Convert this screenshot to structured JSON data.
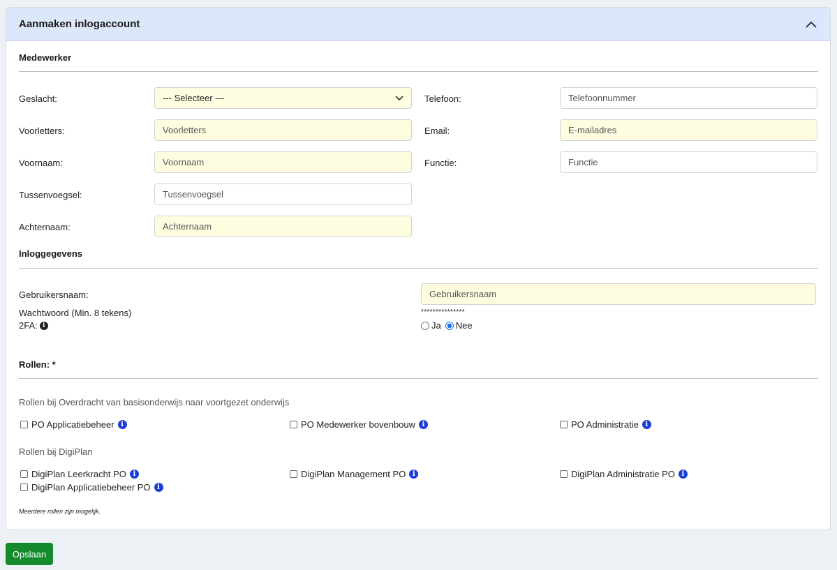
{
  "card": {
    "title": "Aanmaken inlogaccount"
  },
  "medewerker": {
    "section_title": "Medewerker",
    "geslacht": {
      "label": "Geslacht:",
      "value": "--- Selecteer ---"
    },
    "voorletters": {
      "label": "Voorletters:",
      "placeholder": "Voorletters"
    },
    "voornaam": {
      "label": "Voornaam:",
      "placeholder": "Voornaam"
    },
    "tussenvoegsel": {
      "label": "Tussenvoegsel:",
      "placeholder": "Tussenvoegsel"
    },
    "achternaam": {
      "label": "Achternaam:",
      "placeholder": "Achternaam"
    },
    "telefoon": {
      "label": "Telefoon:",
      "placeholder": "Telefoonnummer"
    },
    "email": {
      "label": "Email:",
      "placeholder": "E-mailadres"
    },
    "functie": {
      "label": "Functie:",
      "placeholder": "Functie"
    }
  },
  "inloggegevens": {
    "section_title": "Inloggegevens",
    "gebruikersnaam": {
      "label": "Gebruikersnaam:",
      "placeholder": "Gebruikersnaam"
    },
    "wachtwoord": {
      "label": "Wachtwoord (Min. 8 tekens)",
      "value": "***************"
    },
    "twofa": {
      "label": "2FA:",
      "option_ja": "Ja",
      "option_nee": "Nee",
      "selected": "Nee"
    }
  },
  "rollen": {
    "section_title": "Rollen: *",
    "groups": [
      {
        "title": "Rollen bij Overdracht van basisonderwijs naar voortgezet onderwijs",
        "roles": [
          "PO Applicatiebeheer",
          "PO Medewerker bovenbouw",
          "PO Administratie"
        ]
      },
      {
        "title": "Rollen bij DigiPlan",
        "roles": [
          "DigiPlan Leerkracht PO",
          "DigiPlan Management PO",
          "DigiPlan Administratie PO",
          "DigiPlan Applicatiebeheer PO"
        ]
      }
    ],
    "note": "Meerdere rollen zijn mogelijk."
  },
  "actions": {
    "save_label": "Opslaan"
  },
  "colors": {
    "header_bg": "#dce7fb",
    "required_bg": "#fffde0",
    "save_button": "#138a2c",
    "info_icon": "#1b3fd6"
  }
}
